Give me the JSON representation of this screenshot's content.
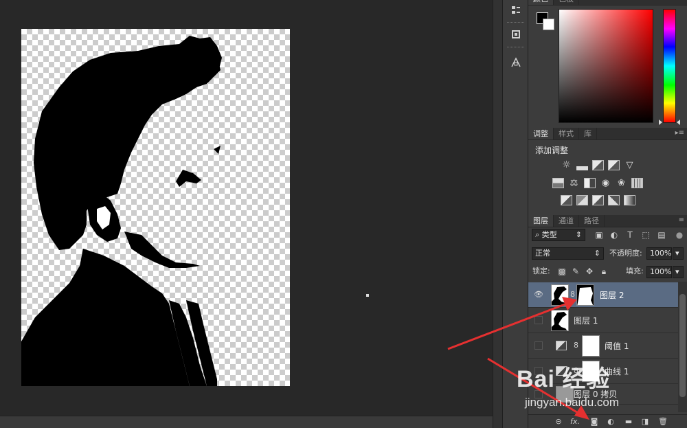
{
  "color_panel": {
    "tabs": [
      "颜色",
      "色板"
    ],
    "foreground": "#000000",
    "background": "#ffffff",
    "hue": "#ff0000"
  },
  "adjustments_panel": {
    "tabs": [
      "调整",
      "样式",
      "库"
    ],
    "title": "添加调整",
    "icons_row1": [
      "brightness-icon",
      "levels-icon",
      "curves-icon",
      "exposure-icon",
      "vibrance-icon"
    ],
    "icons_row2": [
      "hue-saturation-icon",
      "color-balance-icon",
      "black-white-icon",
      "photo-filter-icon",
      "channel-mixer-icon",
      "color-lookup-icon"
    ],
    "icons_row3": [
      "invert-icon",
      "posterize-icon",
      "threshold-icon",
      "selective-color-icon",
      "gradient-map-icon"
    ]
  },
  "layers_panel": {
    "tabs": [
      "图层",
      "通道",
      "路径"
    ],
    "filter_kind": "类型",
    "blend_mode": "正常",
    "opacity_label": "不透明度:",
    "opacity_value": "100%",
    "lock_label": "锁定:",
    "fill_label": "填充:",
    "fill_value": "100%",
    "layers": [
      {
        "name": "图层 2",
        "visible": true,
        "selected": true,
        "has_mask": true
      },
      {
        "name": "图层 1",
        "visible": false,
        "selected": false,
        "has_mask": false
      },
      {
        "name": "阈值 1",
        "visible": false,
        "selected": false,
        "has_mask": true,
        "adjustment": "threshold"
      },
      {
        "name": "曲线 1",
        "visible": false,
        "selected": false,
        "has_mask": true,
        "adjustment": "curves"
      },
      {
        "name": "图层 0 拷贝",
        "visible": false,
        "selected": false,
        "has_mask": false
      }
    ],
    "bottom_icons": [
      "link-layers-icon",
      "fx-icon",
      "add-mask-icon",
      "new-adjustment-icon",
      "new-group-icon",
      "new-layer-icon",
      "delete-layer-icon"
    ],
    "fx_label": "fx."
  },
  "watermark": {
    "brand": "Bai 经验",
    "url": "jingyan.baidu.com"
  }
}
